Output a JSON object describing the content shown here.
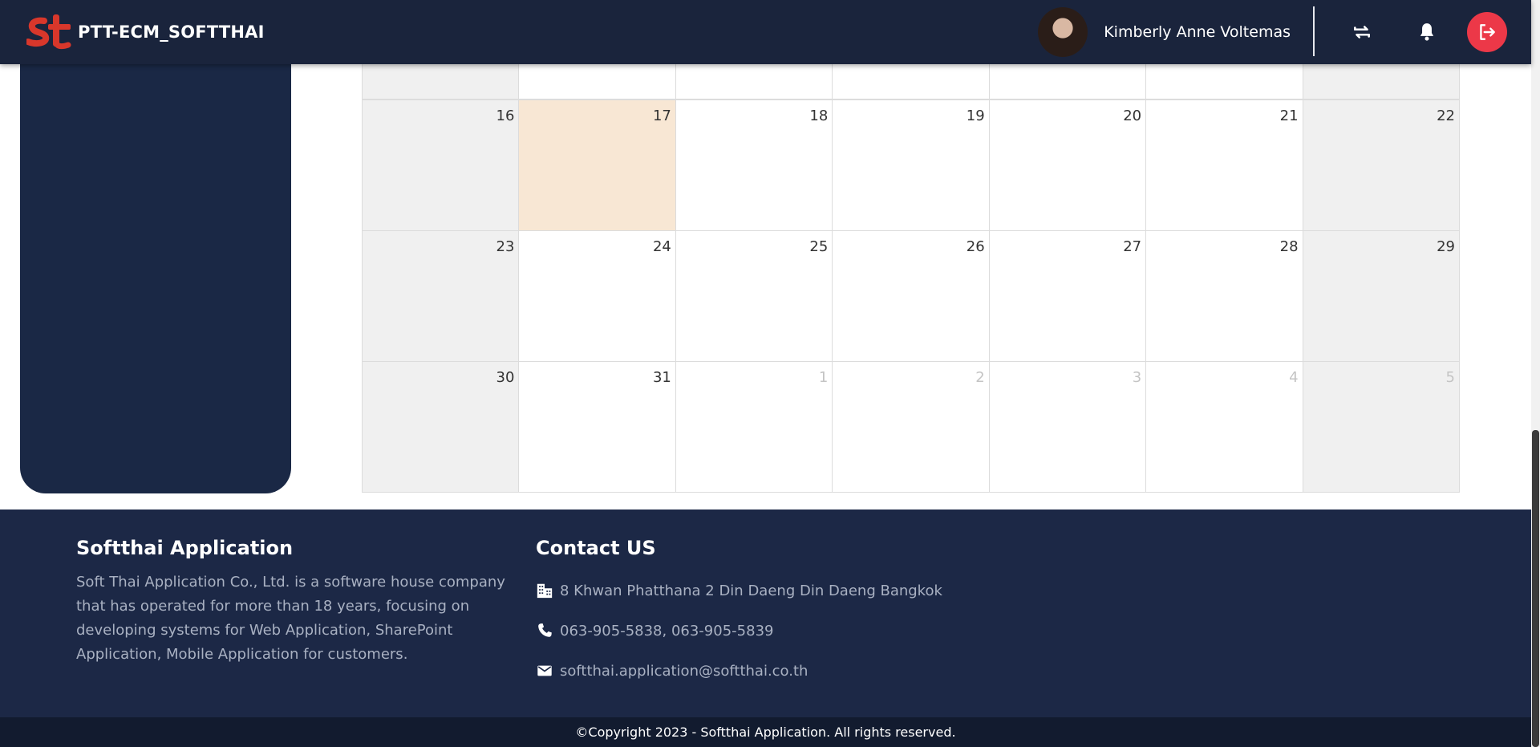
{
  "header": {
    "brand_name": "PTT-ECM_SOFTTHAI",
    "user_name": "Kimberly Anne Voltemas"
  },
  "calendar": {
    "weeks": [
      [
        {
          "day": "16",
          "kind": "weekend"
        },
        {
          "day": "17",
          "kind": "today"
        },
        {
          "day": "18",
          "kind": "normal"
        },
        {
          "day": "19",
          "kind": "normal"
        },
        {
          "day": "20",
          "kind": "normal"
        },
        {
          "day": "21",
          "kind": "normal"
        },
        {
          "day": "22",
          "kind": "weekend"
        }
      ],
      [
        {
          "day": "23",
          "kind": "weekend"
        },
        {
          "day": "24",
          "kind": "normal"
        },
        {
          "day": "25",
          "kind": "normal"
        },
        {
          "day": "26",
          "kind": "normal"
        },
        {
          "day": "27",
          "kind": "normal"
        },
        {
          "day": "28",
          "kind": "normal"
        },
        {
          "day": "29",
          "kind": "weekend"
        }
      ],
      [
        {
          "day": "30",
          "kind": "weekend"
        },
        {
          "day": "31",
          "kind": "normal"
        },
        {
          "day": "1",
          "kind": "other"
        },
        {
          "day": "2",
          "kind": "other"
        },
        {
          "day": "3",
          "kind": "other"
        },
        {
          "day": "4",
          "kind": "other"
        },
        {
          "day": "5",
          "kind": "other-weekend"
        }
      ]
    ]
  },
  "footer": {
    "about_title": "Softthai Application",
    "about_text": "Soft Thai Application Co., Ltd. is a software house company that has operated for more than 18 years, focusing on developing systems for Web Application, SharePoint Application, Mobile Application for customers.",
    "contact_title": "Contact US",
    "address": "8 Khwan Phatthana 2 Din Daeng Din Daeng Bangkok",
    "phone": "063-905-5838, 063-905-5839",
    "email": "softthai.application@softthai.co.th",
    "copyright": "©Copyright 2023 - Softthai Application. All rights reserved."
  },
  "icons": {
    "logo": "softthai-st-logo",
    "swap": "swap-arrows-icon",
    "bell": "bell-icon",
    "logout": "logout-icon",
    "building": "building-icon",
    "phone": "phone-icon",
    "mail": "mail-icon"
  },
  "colors": {
    "header_bg": "#1a243c",
    "footer_bg": "#1c2846",
    "today_bg": "#f8e7d4",
    "logout_accent": "#ec3848",
    "logo_red": "#d8372b"
  }
}
